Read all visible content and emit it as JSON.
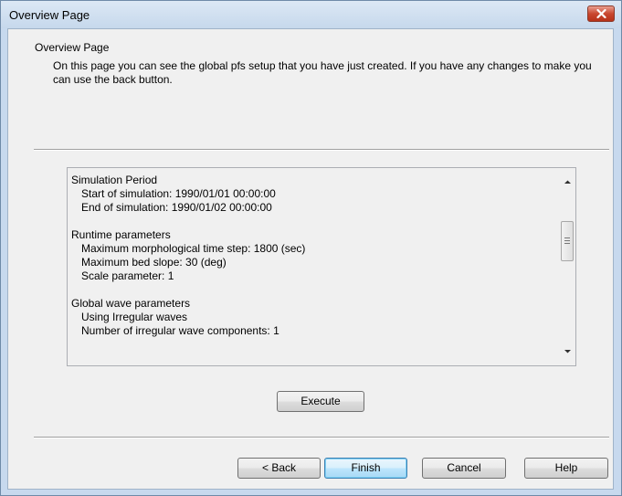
{
  "window": {
    "title": "Overview Page"
  },
  "header": {
    "title": "Overview Page",
    "description": "On this page you can see the global pfs setup that you have just created. If you have any changes to make you can use the back button."
  },
  "summary": {
    "lines": [
      {
        "text": "Simulation Period",
        "indent": false
      },
      {
        "text": "Start of simulation: 1990/01/01 00:00:00",
        "indent": true
      },
      {
        "text": "End of simulation: 1990/01/02 00:00:00",
        "indent": true
      },
      {
        "text": "",
        "indent": false
      },
      {
        "text": "Runtime parameters",
        "indent": false
      },
      {
        "text": "Maximum morphological time step: 1800 (sec)",
        "indent": true
      },
      {
        "text": "Maximum bed slope: 30 (deg)",
        "indent": true
      },
      {
        "text": "Scale parameter: 1",
        "indent": true
      },
      {
        "text": "",
        "indent": false
      },
      {
        "text": "Global wave parameters",
        "indent": false
      },
      {
        "text": "Using Irregular waves",
        "indent": true
      },
      {
        "text": "Number of irregular wave components: 1",
        "indent": true
      }
    ]
  },
  "buttons": {
    "execute": "Execute",
    "back": "< Back",
    "finish": "Finish",
    "cancel": "Cancel",
    "help": "Help"
  },
  "icons": {
    "close": "close-icon",
    "scroll_up": "scroll-up-arrow-icon",
    "scroll_down": "scroll-down-arrow-icon",
    "scroll_grip": "scroll-grip-icon"
  },
  "colors": {
    "titlebar": "#c6d8ec",
    "close_button": "#c9472f",
    "dialog_background": "#f0f0f0",
    "default_button": "#bee6fd"
  }
}
